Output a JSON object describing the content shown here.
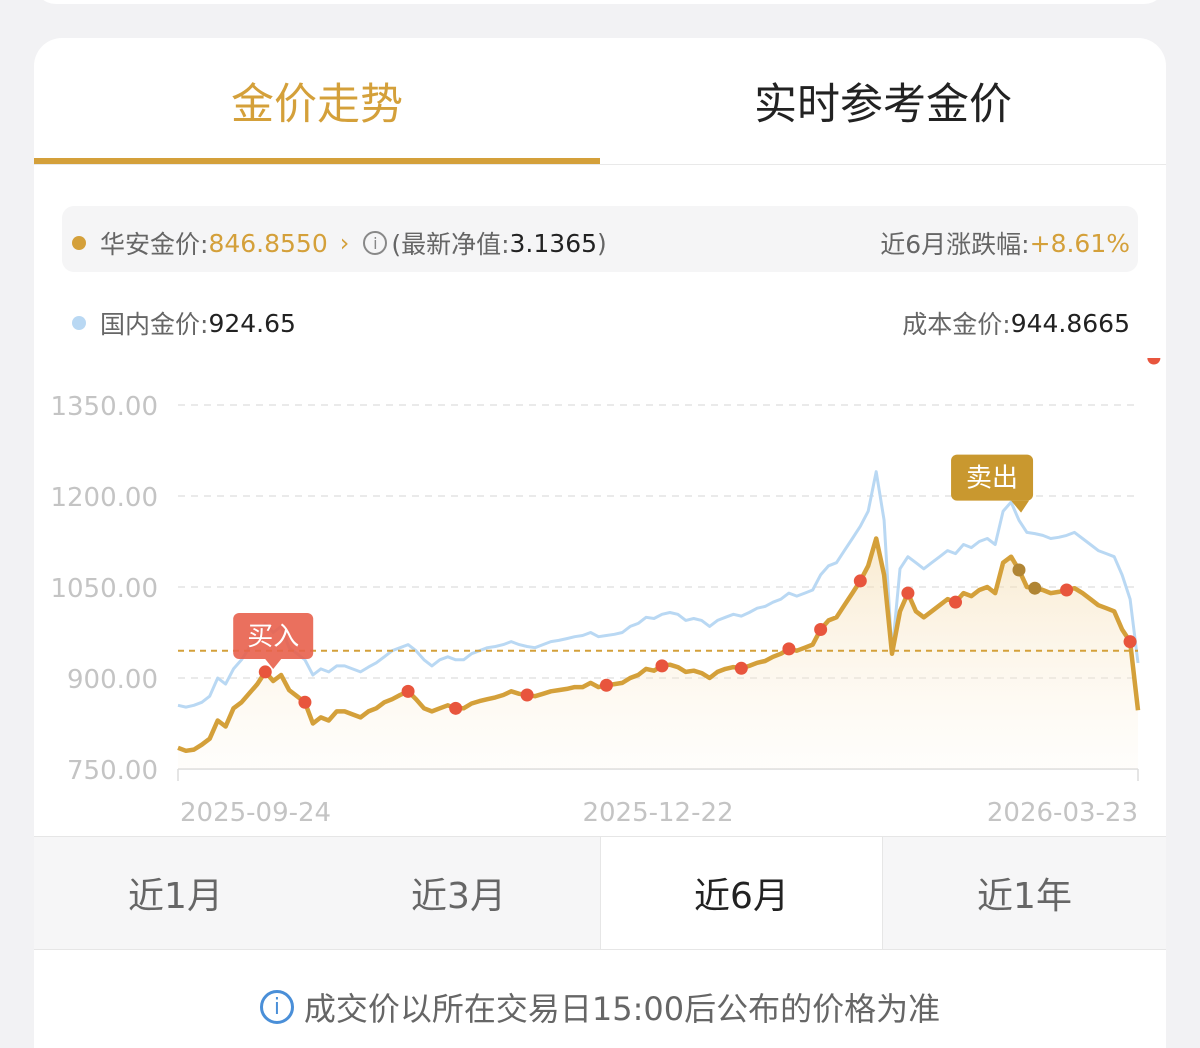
{
  "tabs": [
    {
      "label": "金价走势",
      "active": true
    },
    {
      "label": "实时参考金价",
      "active": false
    }
  ],
  "info": {
    "huaan_label": "华安金价:",
    "huaan_value": "846.8550",
    "nav_label": "(最新净值:",
    "nav_value": "3.1365",
    "nav_close": ")",
    "change_label": "近6月涨跌幅:",
    "change_value": "+8.61%",
    "domestic_label": "国内金价:",
    "domestic_value": "924.65",
    "cost_label": "成本金价:",
    "cost_value": "944.8665"
  },
  "colors": {
    "accent": "#d4a03a",
    "domestic_line": "#b9d8f3",
    "marker": "#e8553d",
    "buy_badge": "#e8604c",
    "sell_badge": "#c9982f"
  },
  "chart_data": {
    "type": "line",
    "y_ticks": [
      "1350.00",
      "1200.00",
      "1050.00",
      "900.00",
      "750.00"
    ],
    "ylim": [
      750,
      1350
    ],
    "x_tick_labels": [
      "2025-09-24",
      "2025-12-22",
      "2026-03-23"
    ],
    "cost_line": 944.8665,
    "annotations": {
      "buy": "买入",
      "sell": "卖出"
    },
    "series": [
      {
        "key": "huaan",
        "values": [
          785,
          780,
          782,
          790,
          800,
          830,
          820,
          850,
          860,
          875,
          890,
          910,
          895,
          905,
          880,
          870,
          860,
          825,
          835,
          830,
          845,
          845,
          840,
          835,
          845,
          850,
          860,
          865,
          872,
          878,
          865,
          850,
          845,
          850,
          855,
          850,
          850,
          858,
          862,
          865,
          868,
          872,
          878,
          874,
          872,
          870,
          874,
          878,
          880,
          882,
          885,
          885,
          892,
          885,
          888,
          890,
          892,
          900,
          905,
          915,
          912,
          920,
          922,
          918,
          910,
          912,
          908,
          900,
          910,
          915,
          918,
          916,
          920,
          925,
          928,
          935,
          940,
          948,
          945,
          950,
          955,
          980,
          995,
          1000,
          1020,
          1040,
          1060,
          1085,
          1130,
          1070,
          940,
          1010,
          1040,
          1010,
          1000,
          1010,
          1020,
          1030,
          1025,
          1040,
          1035,
          1045,
          1050,
          1040,
          1090,
          1100,
          1078,
          1050,
          1048,
          1045,
          1040,
          1042,
          1045,
          1048,
          1040,
          1030,
          1020,
          1015,
          1010,
          980,
          960,
          846.855
        ],
        "markers": [
          11,
          16,
          29,
          35,
          44,
          54,
          61,
          71,
          77,
          81,
          86,
          92,
          98,
          106,
          108,
          112,
          120,
          123
        ]
      },
      {
        "key": "domestic",
        "values": [
          855,
          852,
          855,
          860,
          870,
          900,
          890,
          915,
          930,
          950,
          965,
          990,
          975,
          985,
          950,
          940,
          930,
          905,
          915,
          910,
          920,
          920,
          915,
          910,
          918,
          925,
          935,
          945,
          950,
          955,
          945,
          930,
          920,
          930,
          935,
          930,
          930,
          940,
          945,
          950,
          952,
          955,
          960,
          955,
          952,
          950,
          955,
          960,
          962,
          965,
          968,
          970,
          975,
          968,
          970,
          972,
          975,
          985,
          990,
          1000,
          998,
          1005,
          1008,
          1005,
          995,
          998,
          995,
          985,
          995,
          1000,
          1005,
          1002,
          1008,
          1015,
          1018,
          1025,
          1030,
          1040,
          1035,
          1040,
          1045,
          1070,
          1085,
          1090,
          1110,
          1130,
          1150,
          1175,
          1240,
          1160,
          940,
          1080,
          1100,
          1090,
          1080,
          1090,
          1100,
          1110,
          1105,
          1120,
          1115,
          1125,
          1130,
          1120,
          1175,
          1190,
          1160,
          1140,
          1138,
          1135,
          1130,
          1132,
          1135,
          1140,
          1130,
          1120,
          1110,
          1105,
          1100,
          1070,
          1030,
          924.65
        ]
      }
    ]
  },
  "range_tabs": [
    {
      "label": "近1月",
      "active": false
    },
    {
      "label": "近3月",
      "active": false
    },
    {
      "label": "近6月",
      "active": true
    },
    {
      "label": "近1年",
      "active": false
    }
  ],
  "footnote": "成交价以所在交易日15:00后公布的价格为准"
}
